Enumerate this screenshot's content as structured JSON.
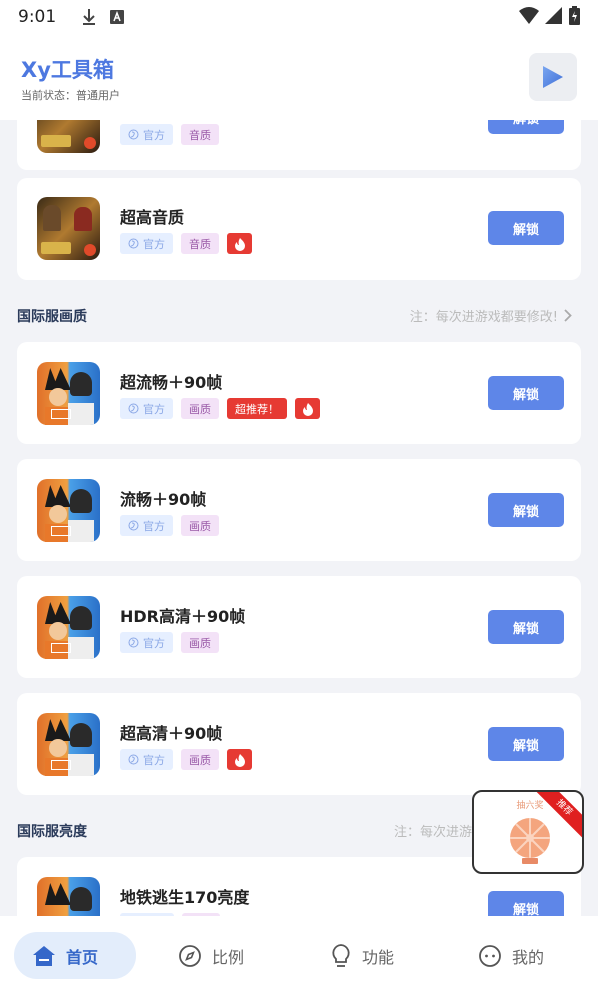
{
  "status_bar": {
    "time": "9:01"
  },
  "header": {
    "title": "Xy工具箱",
    "subtitle": "当前状态：普通用户"
  },
  "tags": {
    "official": "官方",
    "quality_audio": "音质",
    "quality_image": "画质",
    "recommend": "超推荐！"
  },
  "unlock_label": "解锁",
  "sections": [
    {
      "title": "国际服画质",
      "note": "注：每次进游戏都要修改!"
    },
    {
      "title": "国际服亮度",
      "note": "注：每次进游"
    }
  ],
  "items": [
    {
      "name": "",
      "category": "音质",
      "hot": false,
      "recommend": false
    },
    {
      "name": "超高音质",
      "category": "音质",
      "hot": true,
      "recommend": false
    },
    {
      "name": "超流畅＋90帧",
      "category": "画质",
      "hot": true,
      "recommend": true
    },
    {
      "name": "流畅＋90帧",
      "category": "画质",
      "hot": false,
      "recommend": false
    },
    {
      "name": "HDR高清＋90帧",
      "category": "画质",
      "hot": false,
      "recommend": false
    },
    {
      "name": "超高清＋90帧",
      "category": "画质",
      "hot": true,
      "recommend": false
    },
    {
      "name": "地铁逃生170亮度",
      "category": "",
      "hot": false,
      "recommend": false
    }
  ],
  "floating_widget": {
    "label": "抽六奖",
    "ribbon": "推荐"
  },
  "bottom_nav": [
    {
      "label": "首页",
      "icon": "home-icon",
      "active": true
    },
    {
      "label": "比例",
      "icon": "compass-icon",
      "active": false
    },
    {
      "label": "功能",
      "icon": "bulb-icon",
      "active": false
    },
    {
      "label": "我的",
      "icon": "face-icon",
      "active": false
    }
  ],
  "colors": {
    "accent": "#5e86e8",
    "title": "#4d78e0",
    "hot": "#e63a33",
    "nav_active_bg": "#e3edfb"
  }
}
